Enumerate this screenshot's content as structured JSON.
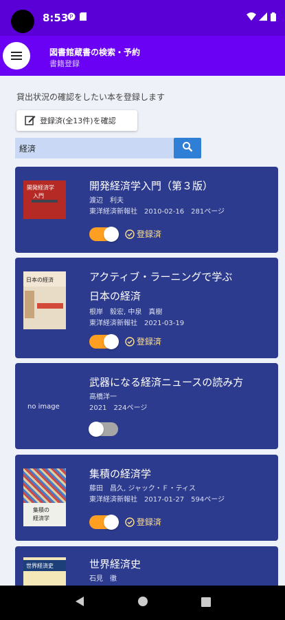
{
  "statusbar": {
    "time": "8:53"
  },
  "appbar": {
    "title": "図書館蔵書の検索・予約",
    "subtitle": "書籍登録"
  },
  "main": {
    "instruction": "貸出状況の確認をしたい本を登録します",
    "registered_button_label": "登録済(全13件)を確認",
    "search_value": "経済"
  },
  "books": [
    {
      "title_lines": [
        "開発経済学入門（第３版）"
      ],
      "author": "渡辺　利夫",
      "details": "東洋経済新報社　2010-02-16　281ページ",
      "registered": true,
      "badge": "登録済",
      "cover_lines": [
        "開発経済学",
        "入門"
      ]
    },
    {
      "title_lines": [
        "アクティブ・ラーニングで学ぶ",
        "日本の経済"
      ],
      "author": "根岸　毅宏, 中泉　真樹",
      "details": "東洋経済新報社　2021-03-19",
      "registered": true,
      "badge": "登録済",
      "cover_lines": [
        "日本の経済"
      ]
    },
    {
      "title_lines": [
        "武器になる経済ニュースの読み方"
      ],
      "author": "高橋洋一",
      "details": "2021　224ページ",
      "registered": false,
      "badge": "",
      "no_image": "no image"
    },
    {
      "title_lines": [
        "集積の経済学"
      ],
      "author": "藤田　昌久, ジャック・Ｆ・ティス",
      "details": "東洋経済新報社　2017-01-27　594ページ",
      "registered": true,
      "badge": "登録済",
      "cover_lines": [
        "集積の",
        "経済学"
      ]
    },
    {
      "title_lines": [
        "世界経済史"
      ],
      "author": "石見　徹",
      "details": "",
      "registered": false,
      "badge": "",
      "cover_lines": [
        "世界経済史"
      ]
    }
  ],
  "colors": {
    "statusbar": "#5a00d6",
    "appbar": "#6a00f4",
    "card": "#2d3b8f",
    "toggle_on": "#ff9f22",
    "badge": "#ffe08a",
    "search_button": "#2f7fd6"
  }
}
